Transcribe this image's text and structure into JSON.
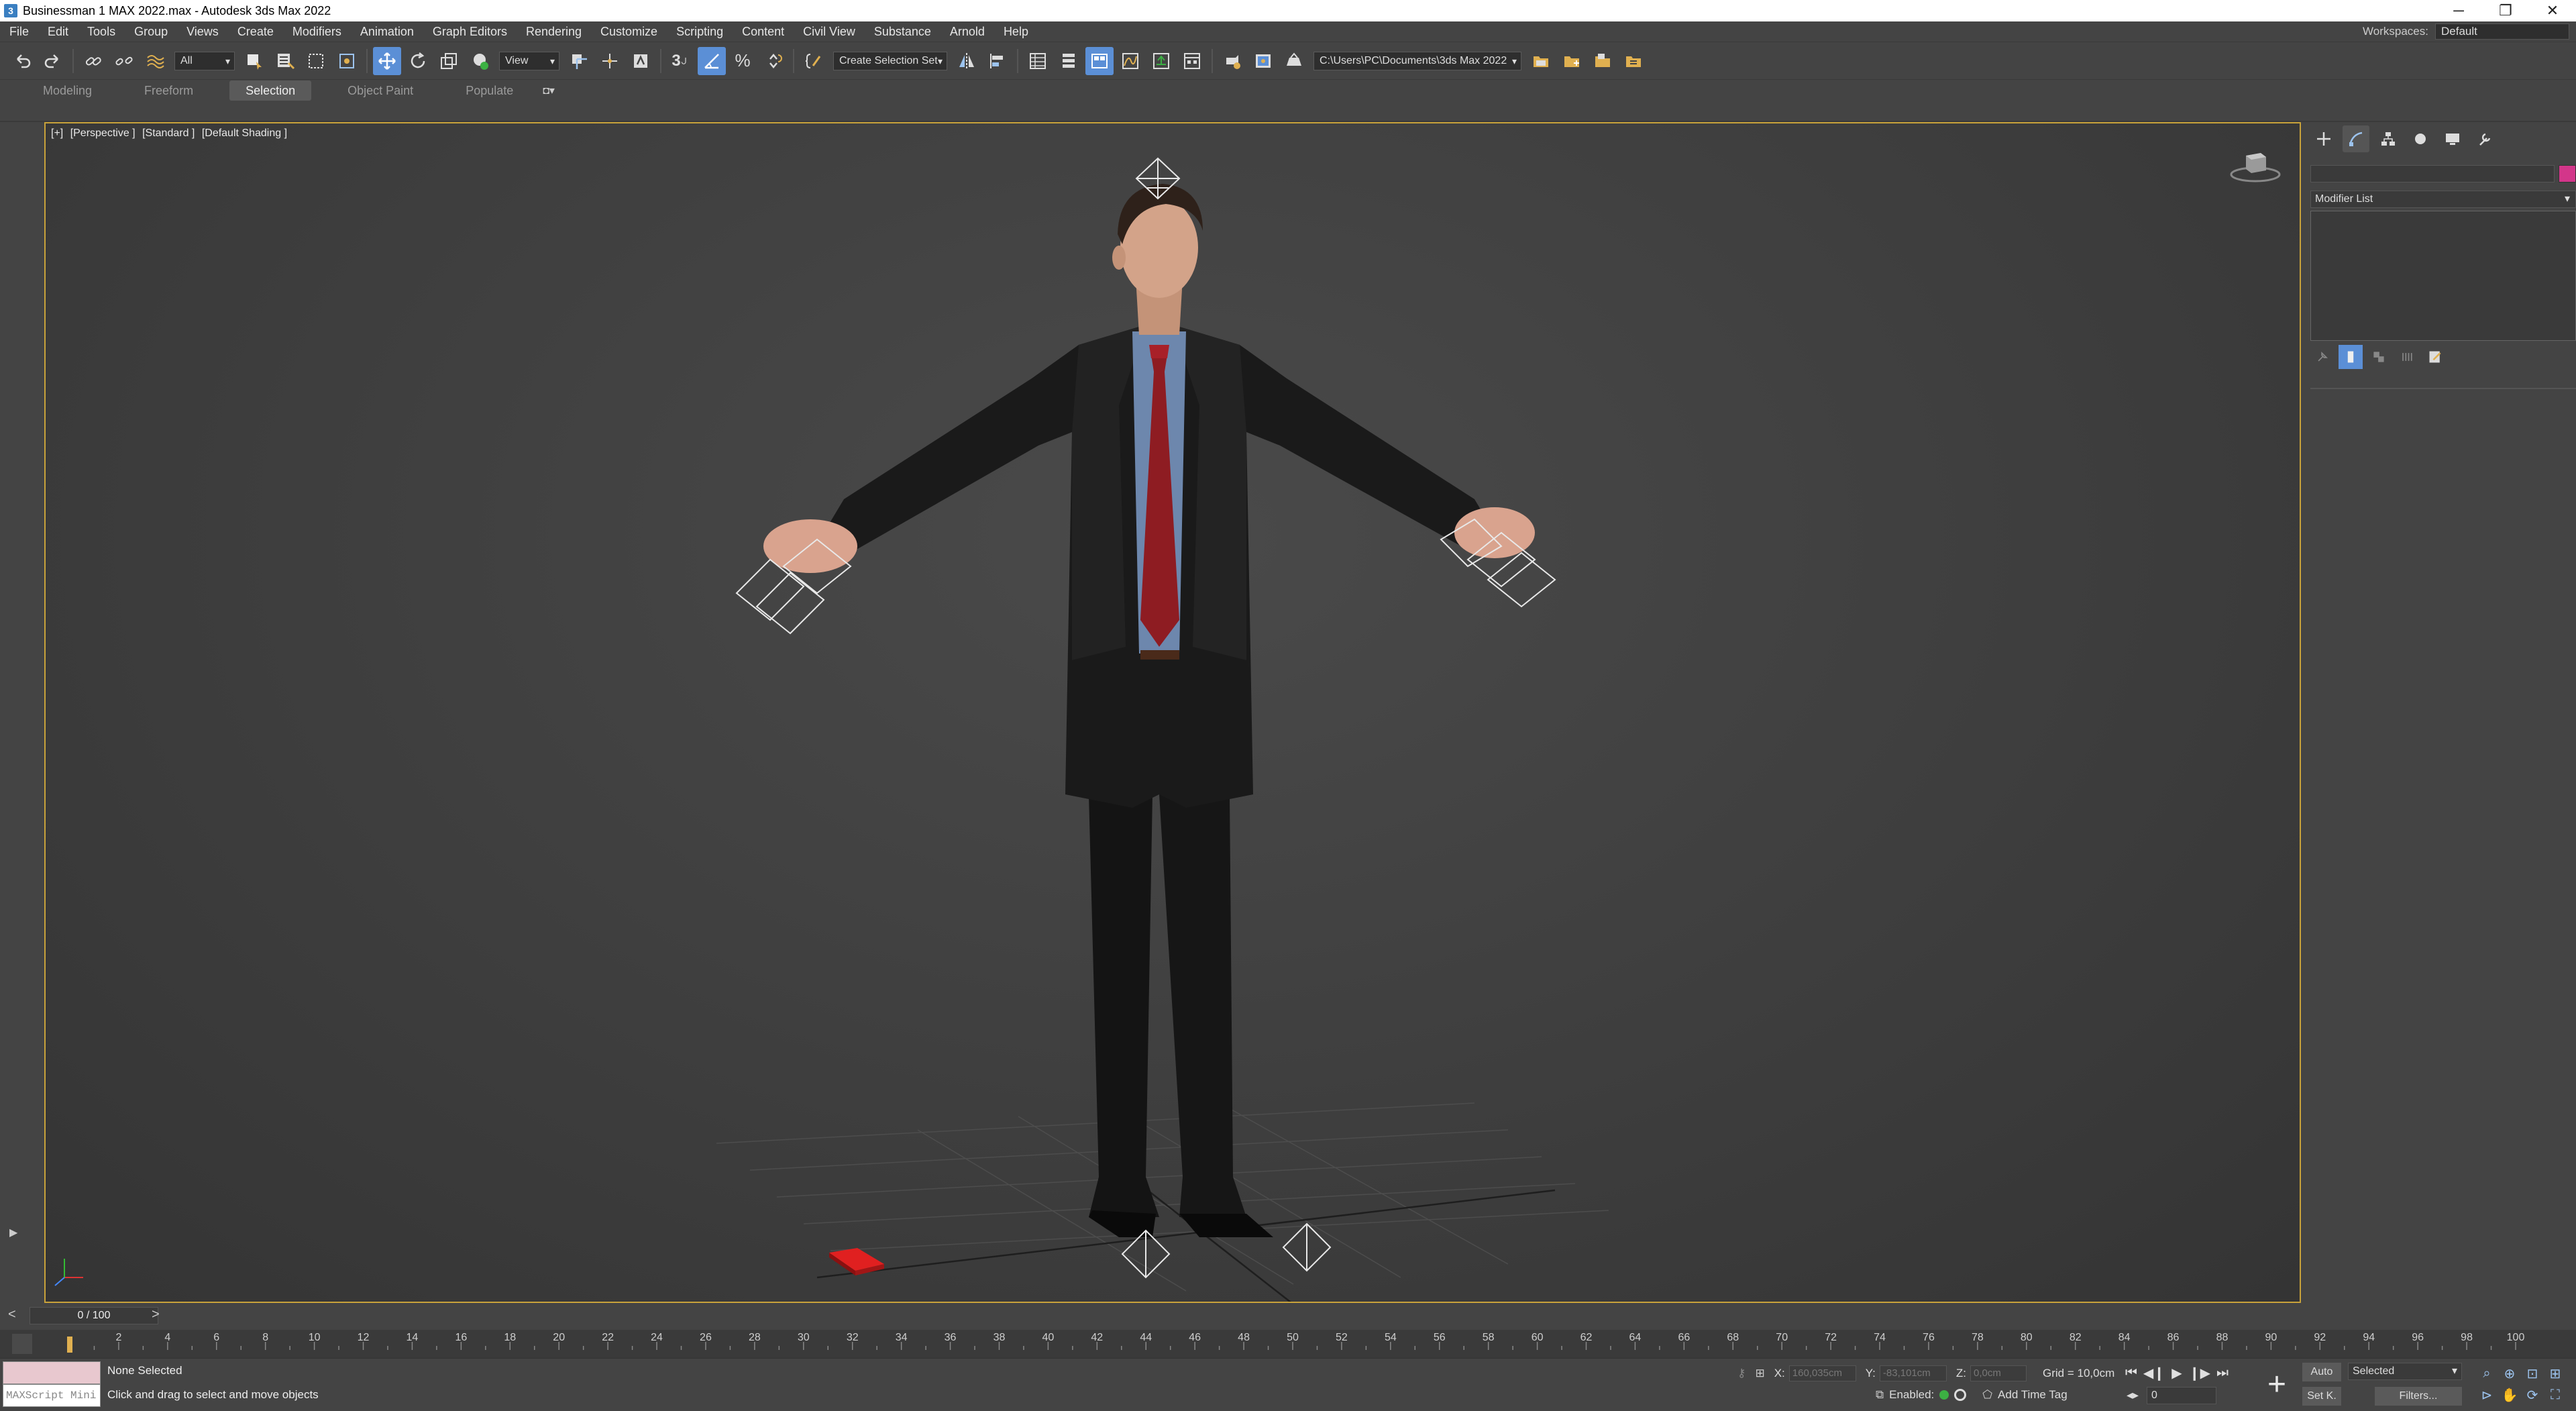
{
  "window": {
    "title": "Businessman 1 MAX 2022.max - Autodesk 3ds Max 2022",
    "controls": [
      "─",
      "❐",
      "✕"
    ]
  },
  "menu": {
    "items": [
      "File",
      "Edit",
      "Tools",
      "Group",
      "Views",
      "Create",
      "Modifiers",
      "Animation",
      "Graph Editors",
      "Rendering",
      "Customize",
      "Scripting",
      "Content",
      "Civil View",
      "Substance",
      "Arnold",
      "Help"
    ],
    "workspaces_label": "Workspaces:",
    "workspaces_value": "Default"
  },
  "toolbar": {
    "selection_filter": "All",
    "reference_coord": "View",
    "snap_label": "3",
    "named_selection": "Create Selection Set",
    "project_path": "C:\\Users\\PC\\Documents\\3ds Max 2022"
  },
  "ribbon": {
    "tabs": [
      "Modeling",
      "Freeform",
      "Selection",
      "Object Paint",
      "Populate"
    ],
    "active_tab": "Selection"
  },
  "viewport": {
    "label_parts": [
      "[+]",
      "[Perspective ]",
      "[Standard ]",
      "[Default Shading ]"
    ],
    "border_color": "#c8a23a"
  },
  "command_panel": {
    "tabs": [
      "create-icon",
      "modify-icon",
      "hierarchy-icon",
      "motion-icon",
      "display-icon",
      "utilities-icon"
    ],
    "active_tab": "modify-icon",
    "object_color": "#d3368a",
    "modifier_list_label": "Modifier List"
  },
  "time_slider": {
    "prev": "<",
    "frame_display": "0 / 100",
    "next": ">"
  },
  "track_bar": {
    "ticks": [
      0,
      2,
      4,
      6,
      8,
      10,
      12,
      14,
      16,
      18,
      20,
      22,
      24,
      26,
      28,
      30,
      32,
      34,
      36,
      38,
      40,
      42,
      44,
      46,
      48,
      50,
      52,
      54,
      56,
      58,
      60,
      62,
      64,
      66,
      68,
      70,
      72,
      74,
      76,
      78,
      80,
      82,
      84,
      86,
      88,
      90,
      92,
      94,
      96,
      98,
      100
    ],
    "current_frame": 0
  },
  "status": {
    "maxscript_placeholder": "MAXScript Mini",
    "selection_info": "None Selected",
    "prompt": "Click and drag to select and move objects",
    "x_label": "X:",
    "x_value": "160,035cm",
    "y_label": "Y:",
    "y_value": "-83,101cm",
    "z_label": "Z:",
    "z_value": "0,0cm",
    "grid": "Grid = 10,0cm",
    "enabled_label": "Enabled:",
    "add_time_tag": "Add Time Tag",
    "auto_key": "Auto",
    "set_key": "Set K.",
    "key_filter": "Selected",
    "filters": "Filters...",
    "current_frame": "0"
  }
}
